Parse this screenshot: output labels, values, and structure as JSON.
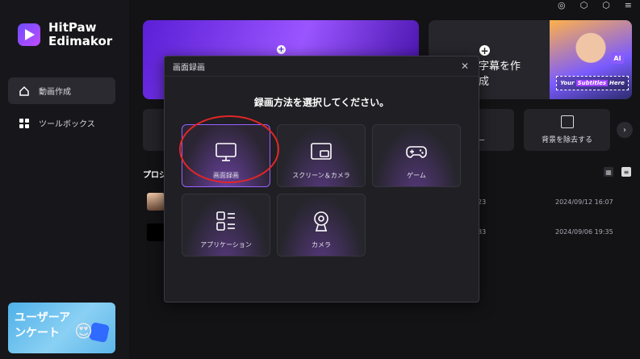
{
  "app": {
    "name_line1": "HitPaw",
    "name_line2": "Edimakor"
  },
  "sidebar": {
    "items": [
      {
        "label": "動画作成",
        "active": true
      },
      {
        "label": "ツールボックス",
        "active": false
      }
    ],
    "survey_banner": {
      "line1": "ユーザーア",
      "line2": "ンケート"
    }
  },
  "main": {
    "feature_card_2": {
      "title_line1": "字幕を作",
      "title_line2": "成",
      "ai_badge": "AI",
      "subtitle_words": [
        "Your",
        "Subtitles",
        "Here"
      ]
    },
    "tools": {
      "partial_label": "ー",
      "remove_bg_label": "背景を除去する"
    },
    "projects": {
      "title": "プロジ",
      "rows": [
        {
          "fragment": "23",
          "date": "2024/09/12 16:07"
        },
        {
          "fragment": "33",
          "date": "2024/09/06 19:35"
        }
      ]
    }
  },
  "modal": {
    "title": "画面録画",
    "heading": "録画方法を選択してください。",
    "options": [
      {
        "label": "画面録画",
        "icon": "monitor-icon",
        "selected": true
      },
      {
        "label": "スクリーン＆カメラ",
        "icon": "screen-camera-icon",
        "selected": false
      },
      {
        "label": "ゲーム",
        "icon": "gamepad-icon",
        "selected": false
      },
      {
        "label": "アプリケーション",
        "icon": "app-grid-icon",
        "selected": false
      },
      {
        "label": "カメラ",
        "icon": "webcam-icon",
        "selected": false
      }
    ]
  },
  "colors": {
    "accent": "#9a60ff",
    "annotation": "#e12626",
    "background": "#131316"
  }
}
